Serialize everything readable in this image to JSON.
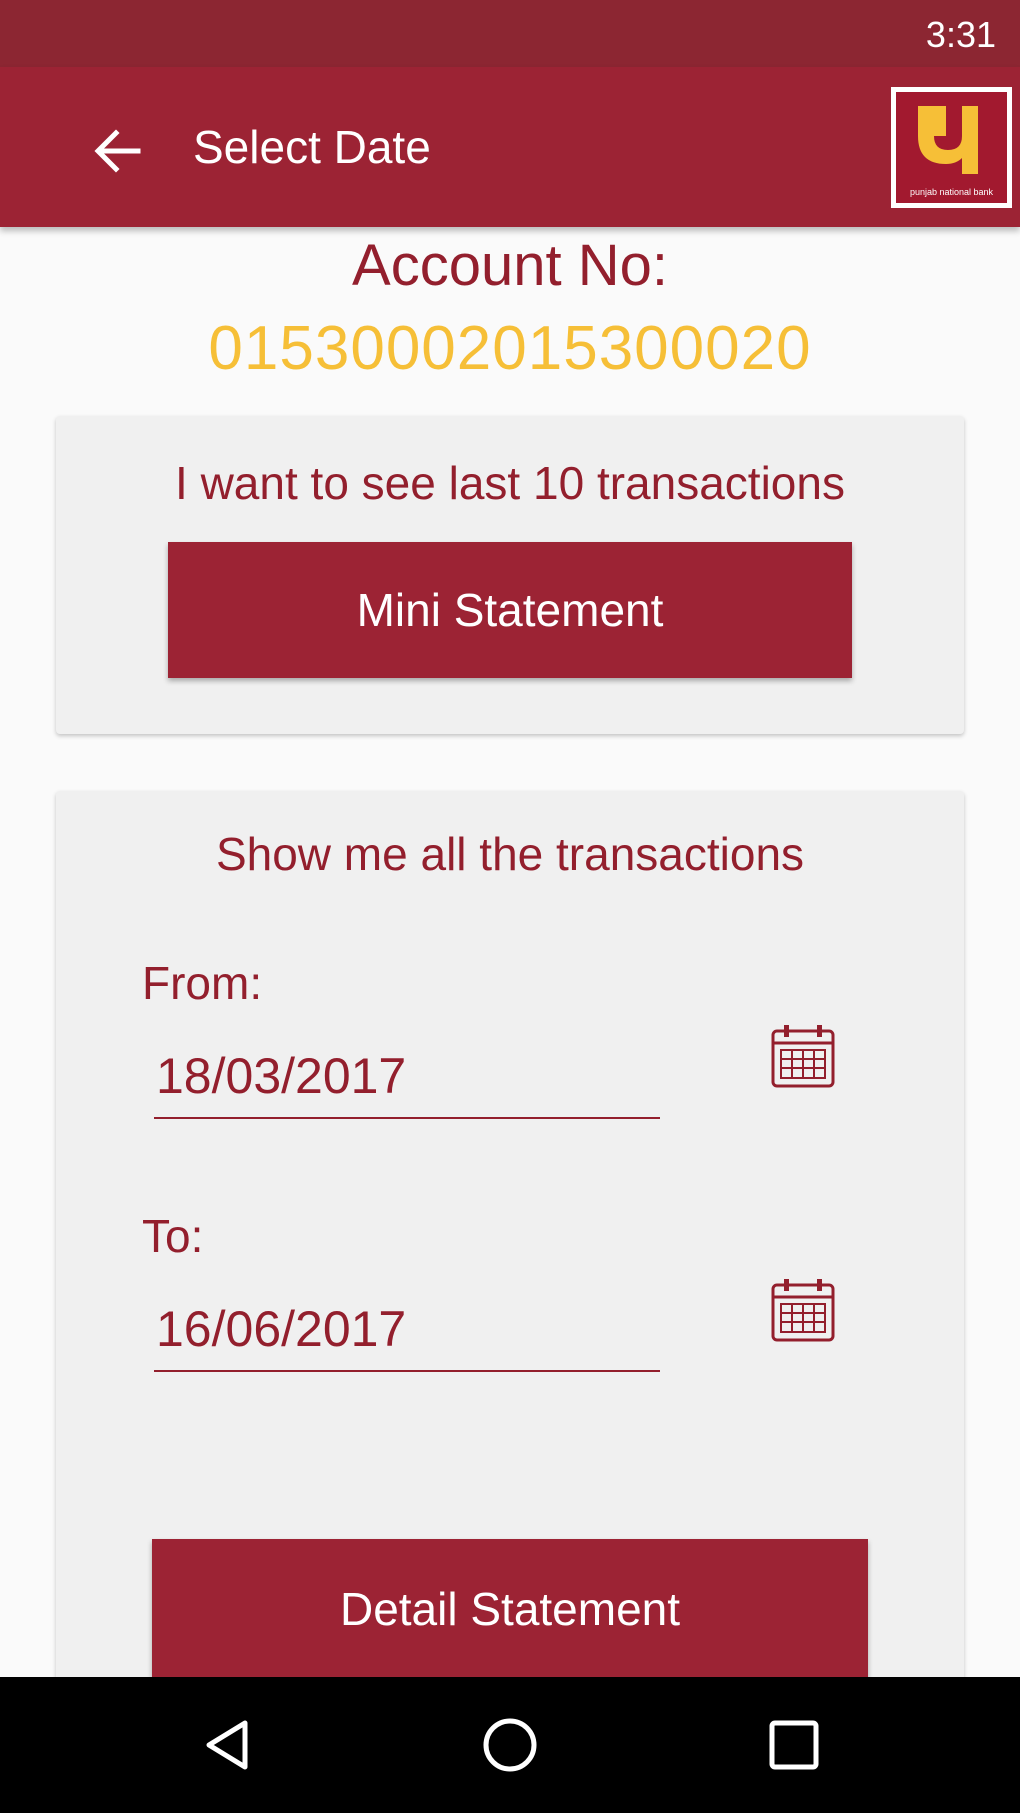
{
  "status_bar": {
    "time": "3:31"
  },
  "app_bar": {
    "title": "Select Date",
    "back_icon": "arrow-back-icon",
    "logo_icon": "pnb-logo-icon",
    "logo_text": "punjab national bank"
  },
  "account": {
    "label": "Account No:",
    "number": "01530002015300020"
  },
  "mini_card": {
    "heading": "I want to see last 10 transactions",
    "button_label": "Mini Statement"
  },
  "detail_card": {
    "heading": "Show me all the transactions",
    "from_label": "From:",
    "from_value": "18/03/2017",
    "to_label": "To:",
    "to_value": "16/06/2017",
    "calendar_icon": "calendar-icon",
    "button_label": "Detail Statement"
  },
  "nav_bar": {
    "back": "nav-back-icon",
    "home": "nav-home-icon",
    "recents": "nav-recents-icon"
  },
  "colors": {
    "primary": "#9c2334",
    "status": "#8c2632",
    "accent": "#f6bf37",
    "text": "#931f2d",
    "card": "#f0f0f0"
  }
}
